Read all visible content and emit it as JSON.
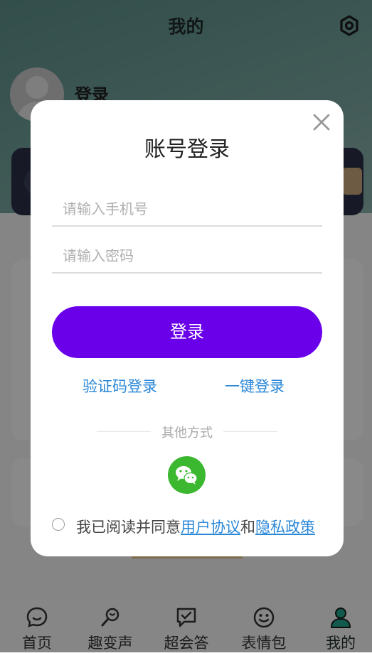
{
  "header": {
    "title": "我的"
  },
  "user": {
    "login_label": "登录"
  },
  "modal": {
    "title": "账号登录",
    "phone_placeholder": "请输入手机号",
    "password_placeholder": "请输入密码",
    "login_button": "登录",
    "sms_login": "验证码登录",
    "onekey_login": "一键登录",
    "other_methods": "其他方式",
    "agreement_prefix": "我已阅读并同意",
    "user_agreement": "用户协议",
    "and": "和",
    "privacy_policy": "隐私政策"
  },
  "tabs": [
    {
      "label": "首页",
      "icon": "message-smile-icon"
    },
    {
      "label": "趣变声",
      "icon": "voice-changer-icon"
    },
    {
      "label": "超会答",
      "icon": "chat-answer-icon"
    },
    {
      "label": "表情包",
      "icon": "emoji-icon"
    },
    {
      "label": "我的",
      "icon": "user-icon"
    }
  ],
  "colors": {
    "accent": "#6a00ea",
    "link": "#2b88d8",
    "wechat": "#3bb830",
    "active_tab": "#1fa58c"
  }
}
